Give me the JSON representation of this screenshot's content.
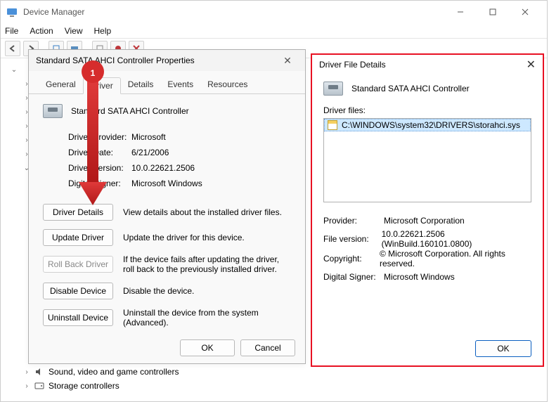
{
  "window": {
    "title": "Device Manager",
    "menu": [
      "File",
      "Action",
      "View",
      "Help"
    ]
  },
  "tree": {
    "visible_children": [
      "Sound, video and game controllers",
      "Storage controllers"
    ]
  },
  "props": {
    "title": "Standard SATA AHCI Controller Properties",
    "tabs": [
      "General",
      "Driver",
      "Details",
      "Events",
      "Resources"
    ],
    "device_name": "Standard SATA AHCI Controller",
    "info": {
      "provider_label": "Driver Provider:",
      "provider": "Microsoft",
      "date_label": "Driver Date:",
      "date": "6/21/2006",
      "version_label": "Driver Version:",
      "version": "10.0.22621.2506",
      "signer_label": "Digital Signer:",
      "signer": "Microsoft Windows"
    },
    "buttons": {
      "details": "Driver Details",
      "details_desc": "View details about the installed driver files.",
      "update": "Update Driver",
      "update_desc": "Update the driver for this device.",
      "rollback": "Roll Back Driver",
      "rollback_desc": "If the device fails after updating the driver, roll back to the previously installed driver.",
      "disable": "Disable Device",
      "disable_desc": "Disable the device.",
      "uninstall": "Uninstall Device",
      "uninstall_desc": "Uninstall the device from the system (Advanced)."
    },
    "ok": "OK",
    "cancel": "Cancel"
  },
  "dfd": {
    "title": "Driver File Details",
    "device_name": "Standard SATA AHCI Controller",
    "driver_files_label": "Driver files:",
    "file": "C:\\WINDOWS\\system32\\DRIVERS\\storahci.sys",
    "rows": {
      "provider_l": "Provider:",
      "provider": "Microsoft Corporation",
      "filever_l": "File version:",
      "filever": "10.0.22621.2506 (WinBuild.160101.0800)",
      "copyright_l": "Copyright:",
      "copyright": "© Microsoft Corporation. All rights reserved.",
      "signer_l": "Digital Signer:",
      "signer": "Microsoft Windows"
    },
    "ok": "OK"
  },
  "annotation": {
    "number": "1"
  }
}
